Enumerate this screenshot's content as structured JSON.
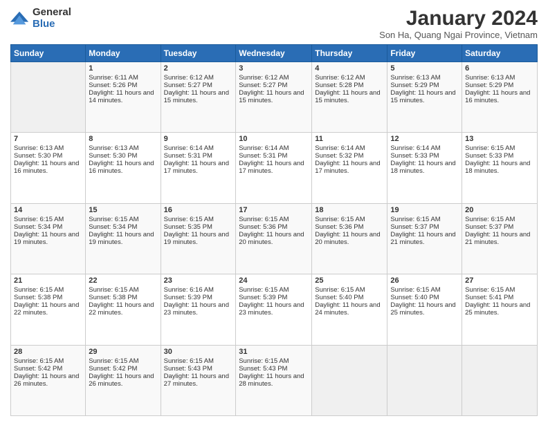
{
  "logo": {
    "general": "General",
    "blue": "Blue"
  },
  "title": {
    "month_year": "January 2024",
    "location": "Son Ha, Quang Ngai Province, Vietnam"
  },
  "weekdays": [
    "Sunday",
    "Monday",
    "Tuesday",
    "Wednesday",
    "Thursday",
    "Friday",
    "Saturday"
  ],
  "weeks": [
    [
      {
        "num": "",
        "sunrise": "",
        "sunset": "",
        "daylight": ""
      },
      {
        "num": "1",
        "sunrise": "Sunrise: 6:11 AM",
        "sunset": "Sunset: 5:26 PM",
        "daylight": "Daylight: 11 hours and 14 minutes."
      },
      {
        "num": "2",
        "sunrise": "Sunrise: 6:12 AM",
        "sunset": "Sunset: 5:27 PM",
        "daylight": "Daylight: 11 hours and 15 minutes."
      },
      {
        "num": "3",
        "sunrise": "Sunrise: 6:12 AM",
        "sunset": "Sunset: 5:27 PM",
        "daylight": "Daylight: 11 hours and 15 minutes."
      },
      {
        "num": "4",
        "sunrise": "Sunrise: 6:12 AM",
        "sunset": "Sunset: 5:28 PM",
        "daylight": "Daylight: 11 hours and 15 minutes."
      },
      {
        "num": "5",
        "sunrise": "Sunrise: 6:13 AM",
        "sunset": "Sunset: 5:29 PM",
        "daylight": "Daylight: 11 hours and 15 minutes."
      },
      {
        "num": "6",
        "sunrise": "Sunrise: 6:13 AM",
        "sunset": "Sunset: 5:29 PM",
        "daylight": "Daylight: 11 hours and 16 minutes."
      }
    ],
    [
      {
        "num": "7",
        "sunrise": "Sunrise: 6:13 AM",
        "sunset": "Sunset: 5:30 PM",
        "daylight": "Daylight: 11 hours and 16 minutes."
      },
      {
        "num": "8",
        "sunrise": "Sunrise: 6:13 AM",
        "sunset": "Sunset: 5:30 PM",
        "daylight": "Daylight: 11 hours and 16 minutes."
      },
      {
        "num": "9",
        "sunrise": "Sunrise: 6:14 AM",
        "sunset": "Sunset: 5:31 PM",
        "daylight": "Daylight: 11 hours and 17 minutes."
      },
      {
        "num": "10",
        "sunrise": "Sunrise: 6:14 AM",
        "sunset": "Sunset: 5:31 PM",
        "daylight": "Daylight: 11 hours and 17 minutes."
      },
      {
        "num": "11",
        "sunrise": "Sunrise: 6:14 AM",
        "sunset": "Sunset: 5:32 PM",
        "daylight": "Daylight: 11 hours and 17 minutes."
      },
      {
        "num": "12",
        "sunrise": "Sunrise: 6:14 AM",
        "sunset": "Sunset: 5:33 PM",
        "daylight": "Daylight: 11 hours and 18 minutes."
      },
      {
        "num": "13",
        "sunrise": "Sunrise: 6:15 AM",
        "sunset": "Sunset: 5:33 PM",
        "daylight": "Daylight: 11 hours and 18 minutes."
      }
    ],
    [
      {
        "num": "14",
        "sunrise": "Sunrise: 6:15 AM",
        "sunset": "Sunset: 5:34 PM",
        "daylight": "Daylight: 11 hours and 19 minutes."
      },
      {
        "num": "15",
        "sunrise": "Sunrise: 6:15 AM",
        "sunset": "Sunset: 5:34 PM",
        "daylight": "Daylight: 11 hours and 19 minutes."
      },
      {
        "num": "16",
        "sunrise": "Sunrise: 6:15 AM",
        "sunset": "Sunset: 5:35 PM",
        "daylight": "Daylight: 11 hours and 19 minutes."
      },
      {
        "num": "17",
        "sunrise": "Sunrise: 6:15 AM",
        "sunset": "Sunset: 5:36 PM",
        "daylight": "Daylight: 11 hours and 20 minutes."
      },
      {
        "num": "18",
        "sunrise": "Sunrise: 6:15 AM",
        "sunset": "Sunset: 5:36 PM",
        "daylight": "Daylight: 11 hours and 20 minutes."
      },
      {
        "num": "19",
        "sunrise": "Sunrise: 6:15 AM",
        "sunset": "Sunset: 5:37 PM",
        "daylight": "Daylight: 11 hours and 21 minutes."
      },
      {
        "num": "20",
        "sunrise": "Sunrise: 6:15 AM",
        "sunset": "Sunset: 5:37 PM",
        "daylight": "Daylight: 11 hours and 21 minutes."
      }
    ],
    [
      {
        "num": "21",
        "sunrise": "Sunrise: 6:15 AM",
        "sunset": "Sunset: 5:38 PM",
        "daylight": "Daylight: 11 hours and 22 minutes."
      },
      {
        "num": "22",
        "sunrise": "Sunrise: 6:15 AM",
        "sunset": "Sunset: 5:38 PM",
        "daylight": "Daylight: 11 hours and 22 minutes."
      },
      {
        "num": "23",
        "sunrise": "Sunrise: 6:16 AM",
        "sunset": "Sunset: 5:39 PM",
        "daylight": "Daylight: 11 hours and 23 minutes."
      },
      {
        "num": "24",
        "sunrise": "Sunrise: 6:15 AM",
        "sunset": "Sunset: 5:39 PM",
        "daylight": "Daylight: 11 hours and 23 minutes."
      },
      {
        "num": "25",
        "sunrise": "Sunrise: 6:15 AM",
        "sunset": "Sunset: 5:40 PM",
        "daylight": "Daylight: 11 hours and 24 minutes."
      },
      {
        "num": "26",
        "sunrise": "Sunrise: 6:15 AM",
        "sunset": "Sunset: 5:40 PM",
        "daylight": "Daylight: 11 hours and 25 minutes."
      },
      {
        "num": "27",
        "sunrise": "Sunrise: 6:15 AM",
        "sunset": "Sunset: 5:41 PM",
        "daylight": "Daylight: 11 hours and 25 minutes."
      }
    ],
    [
      {
        "num": "28",
        "sunrise": "Sunrise: 6:15 AM",
        "sunset": "Sunset: 5:42 PM",
        "daylight": "Daylight: 11 hours and 26 minutes."
      },
      {
        "num": "29",
        "sunrise": "Sunrise: 6:15 AM",
        "sunset": "Sunset: 5:42 PM",
        "daylight": "Daylight: 11 hours and 26 minutes."
      },
      {
        "num": "30",
        "sunrise": "Sunrise: 6:15 AM",
        "sunset": "Sunset: 5:43 PM",
        "daylight": "Daylight: 11 hours and 27 minutes."
      },
      {
        "num": "31",
        "sunrise": "Sunrise: 6:15 AM",
        "sunset": "Sunset: 5:43 PM",
        "daylight": "Daylight: 11 hours and 28 minutes."
      },
      {
        "num": "",
        "sunrise": "",
        "sunset": "",
        "daylight": ""
      },
      {
        "num": "",
        "sunrise": "",
        "sunset": "",
        "daylight": ""
      },
      {
        "num": "",
        "sunrise": "",
        "sunset": "",
        "daylight": ""
      }
    ]
  ]
}
